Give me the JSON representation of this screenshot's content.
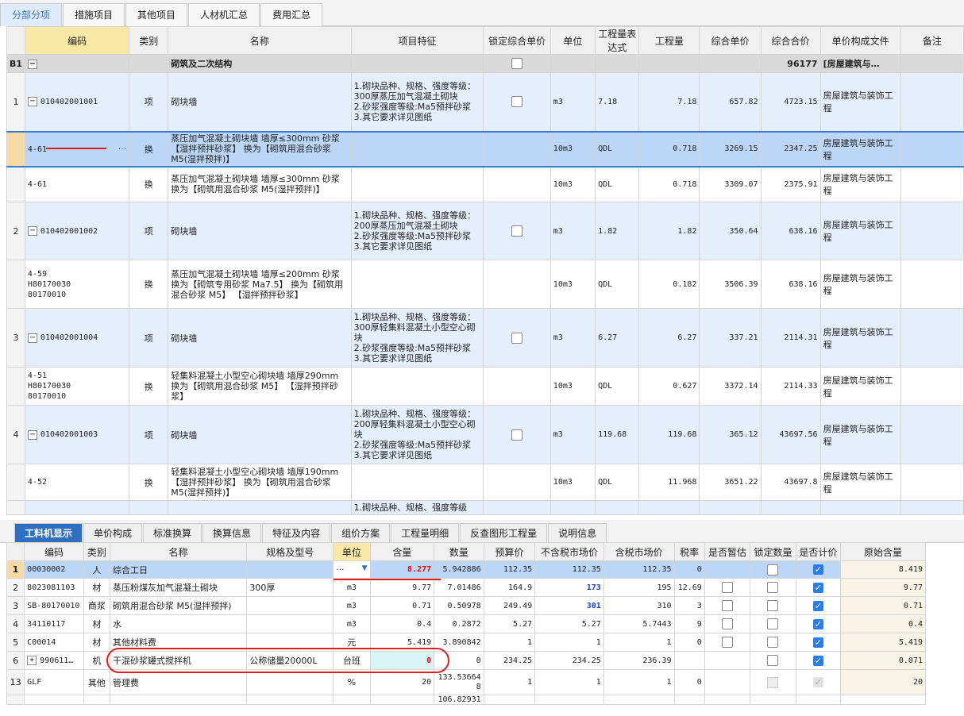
{
  "top_tabs": [
    "分部分项",
    "措施项目",
    "其他项目",
    "人材机汇总",
    "费用汇总"
  ],
  "main_table": {
    "headers": [
      "编码",
      "类别",
      "名称",
      "项目特征",
      "锁定综合单价",
      "单位",
      "工程量表达式",
      "工程量",
      "综合单价",
      "综合合价",
      "单价构成文件",
      "备注"
    ],
    "section": {
      "label": "B1",
      "name": "砌筑及二次结构",
      "total": "96177",
      "file": "[房屋建筑与…"
    },
    "rows": [
      {
        "num": "1",
        "code": "010402001001",
        "type": "项",
        "name": "砌块墙",
        "feature": "1.砌块品种、规格、强度等级：300厚蒸压加气混凝土砌块\n2.砂浆强度等级:Ma5预拌砂浆\n3.其它要求详见图纸",
        "unit": "m3",
        "expr": "7.18",
        "qty": "7.18",
        "price": "657.82",
        "total": "4723.15",
        "file": "房屋建筑与装饰工程"
      },
      {
        "num": "",
        "code": "4-61",
        "type": "换",
        "name": "蒸压加气混凝土砌块墙 墙厚≤300mm 砂浆 【湿拌预拌砂浆】 换为【砌筑用混合砂浆 M5(湿拌预拌)】",
        "feature": "",
        "unit": "10m3",
        "expr": "QDL",
        "qty": "0.718",
        "price": "3269.15",
        "total": "2347.25",
        "file": "房屋建筑与装饰工程"
      },
      {
        "num": "",
        "code": "4-61",
        "type": "换",
        "name": "蒸压加气混凝土砌块墙 墙厚≤300mm 砂浆 换为【砌筑用混合砂浆 M5(湿拌预拌)】",
        "feature": "",
        "unit": "10m3",
        "expr": "QDL",
        "qty": "0.718",
        "price": "3309.07",
        "total": "2375.91",
        "file": "房屋建筑与装饰工程"
      },
      {
        "num": "2",
        "code": "010402001002",
        "type": "项",
        "name": "砌块墙",
        "feature": "1.砌块品种、规格、强度等级：200厚蒸压加气混凝土砌块\n2.砂浆强度等级:Ma5预拌砂浆\n3.其它要求详见图纸",
        "unit": "m3",
        "expr": "1.82",
        "qty": "1.82",
        "price": "350.64",
        "total": "638.16",
        "file": "房屋建筑与装饰工程"
      },
      {
        "num": "",
        "code": "4-59\nH80170030\n80170010",
        "type": "换",
        "name": "蒸压加气混凝土砌块墙 墙厚≤200mm 砂浆 换为【砌筑专用砂浆 Ma7.5】 换为【砌筑用混合砂浆 M5】 【湿拌预拌砂浆】",
        "feature": "",
        "unit": "10m3",
        "expr": "QDL",
        "qty": "0.182",
        "price": "3506.39",
        "total": "638.16",
        "file": "房屋建筑与装饰工程"
      },
      {
        "num": "3",
        "code": "010402001004",
        "type": "项",
        "name": "砌块墙",
        "feature": "1.砌块品种、规格、强度等级：300厚轻集料混凝土小型空心砌块\n2.砂浆强度等级:Ma5预拌砂浆\n3.其它要求详见图纸",
        "unit": "m3",
        "expr": "6.27",
        "qty": "6.27",
        "price": "337.21",
        "total": "2114.31",
        "file": "房屋建筑与装饰工程"
      },
      {
        "num": "",
        "code": "4-51\nH80170030\n80170010",
        "type": "换",
        "name": "轻集料混凝土小型空心砌块墙 墙厚290mm 换为【砌筑用混合砂浆 M5】 【湿拌预拌砂浆】",
        "feature": "",
        "unit": "10m3",
        "expr": "QDL",
        "qty": "0.627",
        "price": "3372.14",
        "total": "2114.33",
        "file": "房屋建筑与装饰工程"
      },
      {
        "num": "4",
        "code": "010402001003",
        "type": "项",
        "name": "砌块墙",
        "feature": "1.砌块品种、规格、强度等级：200厚轻集料混凝土小型空心砌块\n2.砂浆强度等级:Ma5预拌砂浆\n3.其它要求详见图纸",
        "unit": "m3",
        "expr": "119.68",
        "qty": "119.68",
        "price": "365.12",
        "total": "43697.56",
        "file": "房屋建筑与装饰工程"
      },
      {
        "num": "",
        "code": "4-52",
        "type": "换",
        "name": "轻集料混凝土小型空心砌块墙 墙厚190mm 【湿拌预拌砂浆】 换为【砌筑用混合砂浆 M5(湿拌预拌)】",
        "feature": "",
        "unit": "10m3",
        "expr": "QDL",
        "qty": "11.968",
        "price": "3651.22",
        "total": "43697.8",
        "file": "房屋建筑与装饰工程"
      },
      {
        "num": "",
        "code": "",
        "type": "",
        "name": "",
        "feature": "1.砌块品种、规格、强度等级",
        "unit": "",
        "expr": "",
        "qty": "",
        "price": "",
        "total": "",
        "file": ""
      }
    ]
  },
  "bottom_tabs": [
    "工料机显示",
    "单价构成",
    "标准换算",
    "换算信息",
    "特征及内容",
    "组价方案",
    "工程量明细",
    "反查图形工程量",
    "说明信息"
  ],
  "bottom_table": {
    "headers": [
      "编码",
      "类别",
      "名称",
      "规格及型号",
      "单位",
      "含量",
      "数量",
      "预算价",
      "不含税市场价",
      "含税市场价",
      "税率",
      "是否暂估",
      "锁定数量",
      "是否计价",
      "原始含量"
    ],
    "rows": [
      {
        "num": "1",
        "code": "00030002",
        "type": "人",
        "name": "综合工日",
        "spec": "",
        "unit": "···",
        "content": "8.277",
        "amount": "5.942886",
        "budget": "112.35",
        "mkt": "112.35",
        "mkt_tax": "112.35",
        "rate": "0",
        "orig": "8.419"
      },
      {
        "num": "2",
        "code": "8023081103",
        "type": "材",
        "name": "蒸压粉煤灰加气混凝土砌块",
        "spec": "300厚",
        "unit": "m3",
        "content": "9.77",
        "amount": "7.01486",
        "budget": "164.9",
        "mkt": "173",
        "mkt_tax": "195",
        "rate": "12.69",
        "orig": "9.77"
      },
      {
        "num": "3",
        "code": "SB-80170010",
        "type": "商浆",
        "name": "砌筑用混合砂浆 M5(湿拌预拌)",
        "spec": "",
        "unit": "m3",
        "content": "0.71",
        "amount": "0.50978",
        "budget": "249.49",
        "mkt": "301",
        "mkt_tax": "310",
        "rate": "3",
        "orig": "0.71"
      },
      {
        "num": "4",
        "code": "34110117",
        "type": "材",
        "name": "水",
        "spec": "",
        "unit": "m3",
        "content": "0.4",
        "amount": "0.2872",
        "budget": "5.27",
        "mkt": "5.27",
        "mkt_tax": "5.7443",
        "rate": "9",
        "orig": "0.4"
      },
      {
        "num": "5",
        "code": "C00014",
        "type": "材",
        "name": "其他材料费",
        "spec": "",
        "unit": "元",
        "content": "5.419",
        "amount": "3.890842",
        "budget": "1",
        "mkt": "1",
        "mkt_tax": "1",
        "rate": "0",
        "orig": "5.419"
      },
      {
        "num": "6",
        "code": "990611…",
        "type": "机",
        "name": "干混砂浆罐式搅拌机",
        "spec": "公称储量20000L",
        "unit": "台班",
        "content": "0",
        "amount": "0",
        "budget": "234.25",
        "mkt": "234.25",
        "mkt_tax": "236.39",
        "rate": "",
        "orig": "0.071"
      },
      {
        "num": "13",
        "code": "GLF",
        "type": "其他",
        "name": "管理费",
        "spec": "",
        "unit": "%",
        "content": "20",
        "amount": "133.53664\n8",
        "budget": "1",
        "mkt": "1",
        "mkt_tax": "1",
        "rate": "0",
        "orig": "20"
      },
      {
        "num": "",
        "code": "",
        "type": "",
        "name": "",
        "spec": "",
        "unit": "",
        "content": "",
        "amount": "106.82931",
        "budget": "",
        "mkt": "",
        "mkt_tax": "",
        "rate": "",
        "orig": ""
      }
    ]
  },
  "colors": {
    "accent": "#2f6fc2",
    "selected_row": "#bcd6f7",
    "item_row": "#e4eefc",
    "annotation": "#e21d1d"
  }
}
